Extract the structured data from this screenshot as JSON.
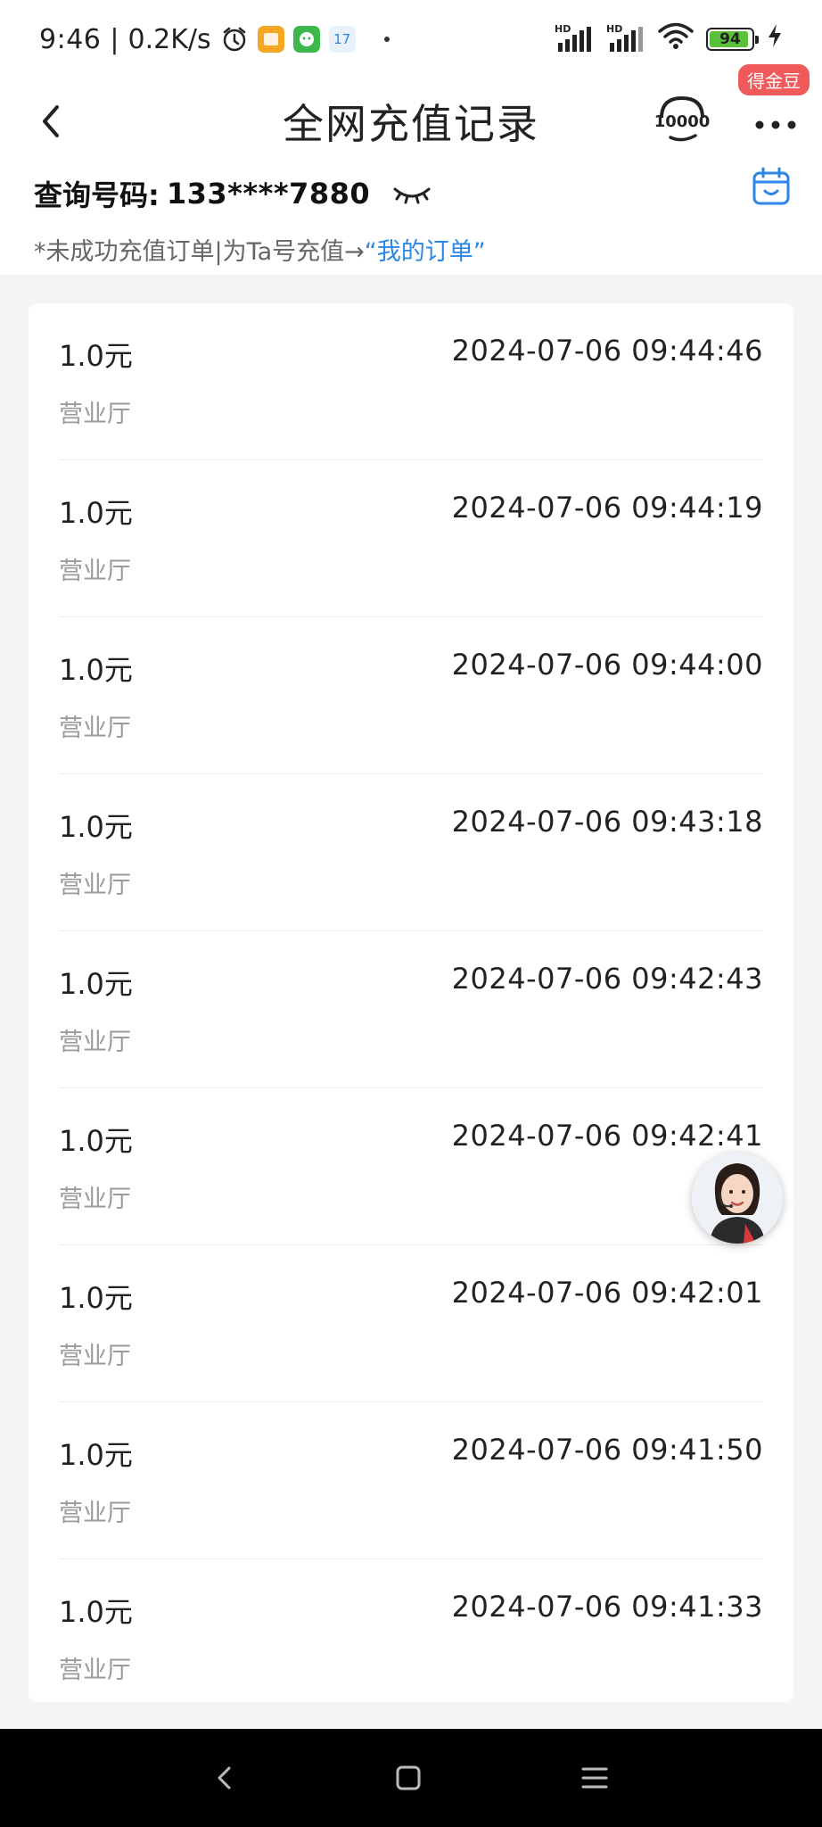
{
  "status_bar": {
    "time": "9:46",
    "net_speed": "0.2K/s",
    "calendar_day": "17",
    "signal_label_1": "HD",
    "signal_label_2": "HD",
    "battery_level": "94",
    "battery_fill_fraction": 0.94
  },
  "header": {
    "title": "全网充值记录",
    "hotline_text": "10000",
    "bonus_badge": "得金豆"
  },
  "query": {
    "label": "查询号码:",
    "number": "133****7880"
  },
  "tip": {
    "text": "*未成功充值订单|为Ta号充值→",
    "link": "“我的订单”"
  },
  "records": [
    {
      "amount": "1.0元",
      "time": "2024-07-06 09:44:46",
      "channel": "营业厅"
    },
    {
      "amount": "1.0元",
      "time": "2024-07-06 09:44:19",
      "channel": "营业厅"
    },
    {
      "amount": "1.0元",
      "time": "2024-07-06 09:44:00",
      "channel": "营业厅"
    },
    {
      "amount": "1.0元",
      "time": "2024-07-06 09:43:18",
      "channel": "营业厅"
    },
    {
      "amount": "1.0元",
      "time": "2024-07-06 09:42:43",
      "channel": "营业厅"
    },
    {
      "amount": "1.0元",
      "time": "2024-07-06 09:42:41",
      "channel": "营业厅"
    },
    {
      "amount": "1.0元",
      "time": "2024-07-06 09:42:01",
      "channel": "营业厅"
    },
    {
      "amount": "1.0元",
      "time": "2024-07-06 09:41:50",
      "channel": "营业厅"
    },
    {
      "amount": "1.0元",
      "time": "2024-07-06 09:41:33",
      "channel": "营业厅"
    }
  ],
  "icons": {
    "back": "back-arrow-icon",
    "hotline": "headset-10000-icon",
    "more": "more-dots-icon",
    "eye": "eye-closed-icon",
    "calendar": "calendar-icon",
    "assistant": "customer-service-avatar",
    "nav_back": "nav-back-icon",
    "nav_home": "nav-home-icon",
    "nav_menu": "nav-menu-icon"
  },
  "colors": {
    "accent_blue": "#2b86e6",
    "badge_red": "#f05a5a",
    "battery_green": "#5cc13a",
    "list_background": "#f5f5f7"
  }
}
